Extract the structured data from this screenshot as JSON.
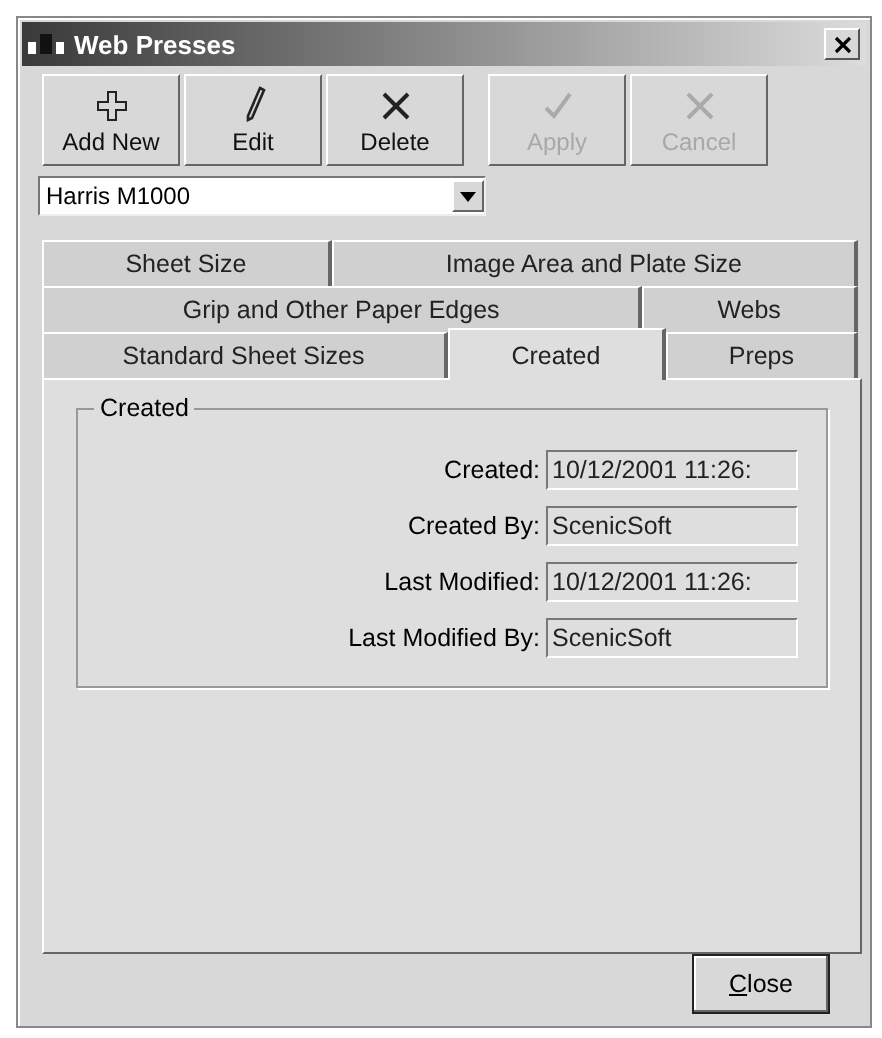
{
  "window": {
    "title": "Web Presses"
  },
  "toolbar": [
    {
      "label": "Add New",
      "kind": "add",
      "disabled": false
    },
    {
      "label": "Edit",
      "kind": "edit",
      "disabled": false
    },
    {
      "label": "Delete",
      "kind": "delete",
      "disabled": false
    },
    {
      "label": "Apply",
      "kind": "apply",
      "disabled": true
    },
    {
      "label": "Cancel",
      "kind": "cancel",
      "disabled": true
    }
  ],
  "press_select": {
    "value": "Harris M1000"
  },
  "tab_rows": [
    [
      {
        "label": "Sheet Size",
        "selected": false
      },
      {
        "label": "Image Area and Plate Size",
        "selected": false
      }
    ],
    [
      {
        "label": "Grip and Other Paper Edges",
        "selected": false
      },
      {
        "label": "Webs",
        "selected": false
      }
    ],
    [
      {
        "label": "Standard Sheet Sizes",
        "selected": false
      },
      {
        "label": "Created",
        "selected": true
      },
      {
        "label": "Preps",
        "selected": false
      }
    ]
  ],
  "group": {
    "title": "Created",
    "fields": [
      {
        "label": "Created:",
        "value": "10/12/2001 11:26:"
      },
      {
        "label": "Created By:",
        "value": "ScenicSoft"
      },
      {
        "label": "Last Modified:",
        "value": "10/12/2001 11:26:"
      },
      {
        "label": "Last Modified By:",
        "value": "ScenicSoft"
      }
    ]
  },
  "close_button": {
    "label": "Close"
  }
}
